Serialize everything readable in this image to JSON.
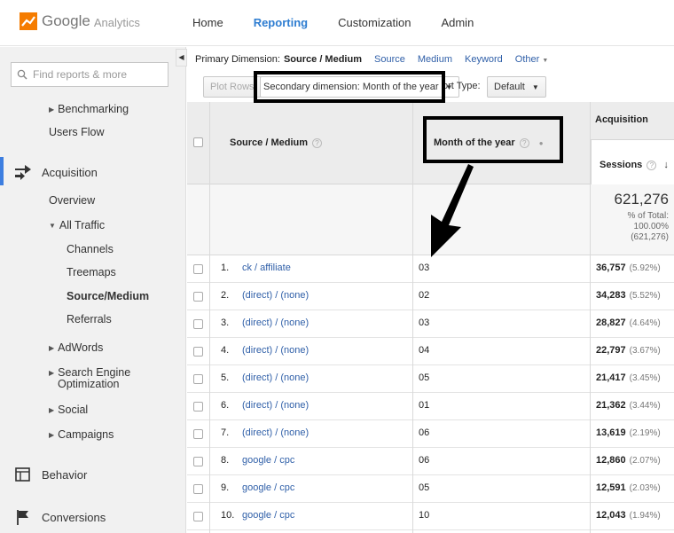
{
  "header": {
    "logo_google": "Google",
    "logo_analytics": "Analytics",
    "nav": [
      "Home",
      "Reporting",
      "Customization",
      "Admin"
    ],
    "active_nav": "Reporting",
    "accent_color": "#2e7dd1"
  },
  "sidebar": {
    "search_placeholder": "Find reports & more",
    "benchmarking": "Benchmarking",
    "users_flow": "Users Flow",
    "acquisition": "Acquisition",
    "overview": "Overview",
    "all_traffic": "All Traffic",
    "channels": "Channels",
    "treemaps": "Treemaps",
    "source_medium": "Source/Medium",
    "referrals": "Referrals",
    "adwords": "AdWords",
    "seo_line1": "Search Engine",
    "seo_line2": "Optimization",
    "social": "Social",
    "campaigns": "Campaigns",
    "behavior": "Behavior",
    "conversions": "Conversions"
  },
  "dimensions": {
    "label": "Primary Dimension:",
    "current": "Source / Medium",
    "links": [
      "Source",
      "Medium",
      "Keyword"
    ],
    "other": "Other"
  },
  "toolbar": {
    "plot_rows": "Plot Rows",
    "secondary": "Secondary dimension: Month of the year",
    "sort_type_label": "ort Type:",
    "sort_value": "Default"
  },
  "table": {
    "col_source": "Source / Medium",
    "col_month": "Month of the year",
    "group_acquisition": "Acquisition",
    "col_sessions": "Sessions",
    "totals": {
      "value": "621,276",
      "line1": "% of Total:",
      "line2": "100.00%",
      "line3": "(621,276)"
    },
    "rows": [
      {
        "idx": "1.",
        "source": "ck / affiliate",
        "month": "03",
        "sessions": "36,757",
        "pct": "(5.92%)"
      },
      {
        "idx": "2.",
        "source": "(direct) / (none)",
        "month": "02",
        "sessions": "34,283",
        "pct": "(5.52%)"
      },
      {
        "idx": "3.",
        "source": "(direct) / (none)",
        "month": "03",
        "sessions": "28,827",
        "pct": "(4.64%)"
      },
      {
        "idx": "4.",
        "source": "(direct) / (none)",
        "month": "04",
        "sessions": "22,797",
        "pct": "(3.67%)"
      },
      {
        "idx": "5.",
        "source": "(direct) / (none)",
        "month": "05",
        "sessions": "21,417",
        "pct": "(3.45%)"
      },
      {
        "idx": "6.",
        "source": "(direct) / (none)",
        "month": "01",
        "sessions": "21,362",
        "pct": "(3.44%)"
      },
      {
        "idx": "7.",
        "source": "(direct) / (none)",
        "month": "06",
        "sessions": "13,619",
        "pct": "(2.19%)"
      },
      {
        "idx": "8.",
        "source": "google / cpc",
        "month": "06",
        "sessions": "12,860",
        "pct": "(2.07%)"
      },
      {
        "idx": "9.",
        "source": "google / cpc",
        "month": "05",
        "sessions": "12,591",
        "pct": "(2.03%)"
      },
      {
        "idx": "10.",
        "source": "google / cpc",
        "month": "10",
        "sessions": "12,043",
        "pct": "(1.94%)"
      }
    ]
  }
}
